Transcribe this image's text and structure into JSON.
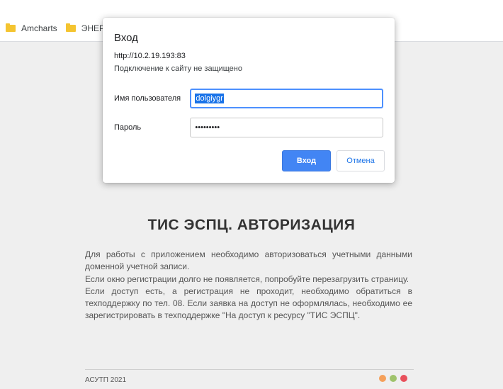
{
  "bookmarks": {
    "items": [
      {
        "label": "Amcharts"
      },
      {
        "label": "ЭНЕРГ"
      }
    ]
  },
  "dialog": {
    "title": "Вход",
    "url": "http://10.2.19.193:83",
    "warning": "Подключение к сайту не защищено",
    "username_label": "Имя пользователя",
    "username_value": "dolgiygr",
    "password_label": "Пароль",
    "password_mask": "•••••••••",
    "login_button": "Вход",
    "cancel_button": "Отмена"
  },
  "page": {
    "title": "ТИС ЭСПЦ. АВТОРИЗАЦИЯ",
    "description": "Для работы с приложением необходимо авторизоваться учетными данными доменной учетной записи.\nЕсли окно регистрации долго не появляется, попробуйте перезагрузить страницу.\nЕсли доступ есть, а регистрация не проходит, необходимо обратиться в техподдержку по тел. 08. Если заявка на доступ не оформлялась, необходимо ее зарегистрировать в техподдержке \"На доступ к ресурсу \"ТИС ЭСПЦ\".",
    "footer": "АСУТП 2021"
  },
  "colors": {
    "dot_orange": "#f5a05a",
    "dot_green": "#9fc36c",
    "dot_red": "#e8505b",
    "accent": "#4285f4"
  }
}
